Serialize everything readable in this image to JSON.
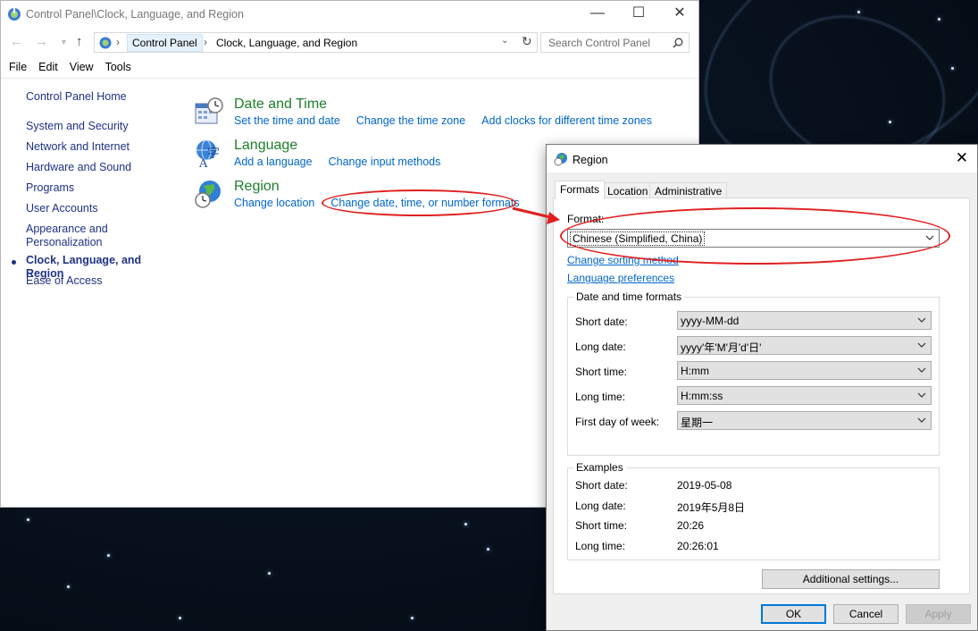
{
  "control_panel": {
    "window_title": "Control Panel\\Clock, Language, and Region",
    "breadcrumb": [
      "Control Panel",
      "Clock, Language, and Region"
    ],
    "search_placeholder": "Search Control Panel",
    "menu": [
      "File",
      "Edit",
      "View",
      "Tools"
    ],
    "sidebar": [
      {
        "label": "Control Panel Home"
      },
      {
        "label": "System and Security"
      },
      {
        "label": "Network and Internet"
      },
      {
        "label": "Hardware and Sound"
      },
      {
        "label": "Programs"
      },
      {
        "label": "User Accounts"
      },
      {
        "label": "Appearance and Personalization"
      },
      {
        "label": "Clock, Language, and Region"
      },
      {
        "label": "Ease of Access"
      }
    ],
    "categories": [
      {
        "title": "Date and Time",
        "icon": "clock-calendar-icon",
        "links": [
          "Set the time and date",
          "Change the time zone",
          "Add clocks for different time zones"
        ]
      },
      {
        "title": "Language",
        "icon": "language-icon",
        "links": [
          "Add a language",
          "Change input methods"
        ]
      },
      {
        "title": "Region",
        "icon": "globe-clock-icon",
        "links": [
          "Change location",
          "Change date, time, or number formats"
        ]
      }
    ]
  },
  "region_dialog": {
    "title": "Region",
    "tabs": [
      "Formats",
      "Location",
      "Administrative"
    ],
    "format_label": "Format:",
    "format_value": "Chinese (Simplified, China)",
    "links": [
      "Change sorting method",
      "Language preferences"
    ],
    "date_time_group": "Date and time formats",
    "fields": [
      {
        "label": "Short date:",
        "value": "yyyy-MM-dd"
      },
      {
        "label": "Long date:",
        "value": "yyyy'年'M'月'd'日'"
      },
      {
        "label": "Short time:",
        "value": "H:mm"
      },
      {
        "label": "Long time:",
        "value": "H:mm:ss"
      },
      {
        "label": "First day of week:",
        "value": "星期一"
      }
    ],
    "examples_group": "Examples",
    "examples": [
      {
        "label": "Short date:",
        "value": "2019-05-08"
      },
      {
        "label": "Long date:",
        "value": "2019年5月8日"
      },
      {
        "label": "Short time:",
        "value": "20:26"
      },
      {
        "label": "Long time:",
        "value": "20:26:01"
      }
    ],
    "additional_settings": "Additional settings...",
    "ok": "OK",
    "cancel": "Cancel",
    "apply": "Apply"
  },
  "colors": {
    "annotation": "#e02020",
    "link": "#0066cc",
    "category_title": "#1e7e2a"
  }
}
